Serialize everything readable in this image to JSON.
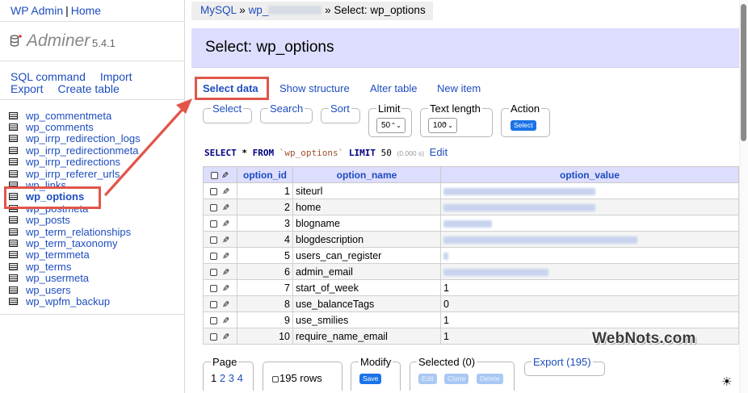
{
  "sidebar": {
    "top_links": [
      "WP Admin",
      "Home"
    ],
    "logo_name": "Adminer",
    "logo_version": "5.4.1",
    "actions_row1": [
      "SQL command",
      "Import"
    ],
    "actions_row2": [
      "Export",
      "Create table"
    ],
    "tables": [
      "wp_commentmeta",
      "wp_comments",
      "wp_irrp_redirection_logs",
      "wp_irrp_redirectionmeta",
      "wp_irrp_redirections",
      "wp_irrp_referer_urls",
      "wp_links",
      "wp_options",
      "wp_postmeta",
      "wp_posts",
      "wp_term_relationships",
      "wp_term_taxonomy",
      "wp_termmeta",
      "wp_terms",
      "wp_usermeta",
      "wp_users",
      "wp_wpfm_backup"
    ],
    "active_table": "wp_options"
  },
  "breadcrumb": {
    "root": "MySQL",
    "sep": "»",
    "db_prefix": "wp_",
    "current": "Select: wp_options"
  },
  "page_title": "Select: wp_options",
  "tabs": [
    "Select data",
    "Show structure",
    "Alter table",
    "New item"
  ],
  "controls": {
    "select": "Select",
    "search": "Search",
    "sort": "Sort",
    "limit_legend": "Limit",
    "limit_value": "50",
    "text_length_legend": "Text length",
    "text_length_value": "100",
    "action_legend": "Action",
    "action_button": "Select"
  },
  "query": {
    "select_kw": "SELECT",
    "star": "*",
    "from_kw": "FROM",
    "table": "`wp_options`",
    "limit_kw": "LIMIT",
    "limit": "50",
    "time": "(0.000 s)",
    "edit": "Edit"
  },
  "table": {
    "headers": [
      "option_id",
      "option_name",
      "option_value"
    ],
    "rows": [
      {
        "id": "1",
        "name": "siteurl",
        "value": "",
        "blur_w": 188
      },
      {
        "id": "2",
        "name": "home",
        "value": "",
        "blur_w": 188
      },
      {
        "id": "3",
        "name": "blogname",
        "value": "",
        "blur_w": 60
      },
      {
        "id": "4",
        "name": "blogdescription",
        "value": "",
        "blur_w": 240
      },
      {
        "id": "5",
        "name": "users_can_register",
        "value": "",
        "blur_w": 6
      },
      {
        "id": "6",
        "name": "admin_email",
        "value": "",
        "blur_w": 130
      },
      {
        "id": "7",
        "name": "start_of_week",
        "value": "1"
      },
      {
        "id": "8",
        "name": "use_balanceTags",
        "value": "0"
      },
      {
        "id": "9",
        "name": "use_smilies",
        "value": "1"
      },
      {
        "id": "10",
        "name": "require_name_email",
        "value": "1"
      }
    ]
  },
  "footer": {
    "page_legend": "Page",
    "pages": [
      "1",
      "2",
      "3",
      "4"
    ],
    "rows_label": "195 rows",
    "modify_legend": "Modify",
    "save_button": "Save",
    "selected_legend": "Selected (0)",
    "edit_button": "Edit",
    "clone_button": "Clone",
    "delete_button": "Delete",
    "export_legend": "Export (195)"
  },
  "watermark": "WebNots.com",
  "colors": {
    "link": "#1d4dbf",
    "header_bg": "#ddddfe",
    "highlight": "#e2554a",
    "button": "#1a73e8"
  }
}
